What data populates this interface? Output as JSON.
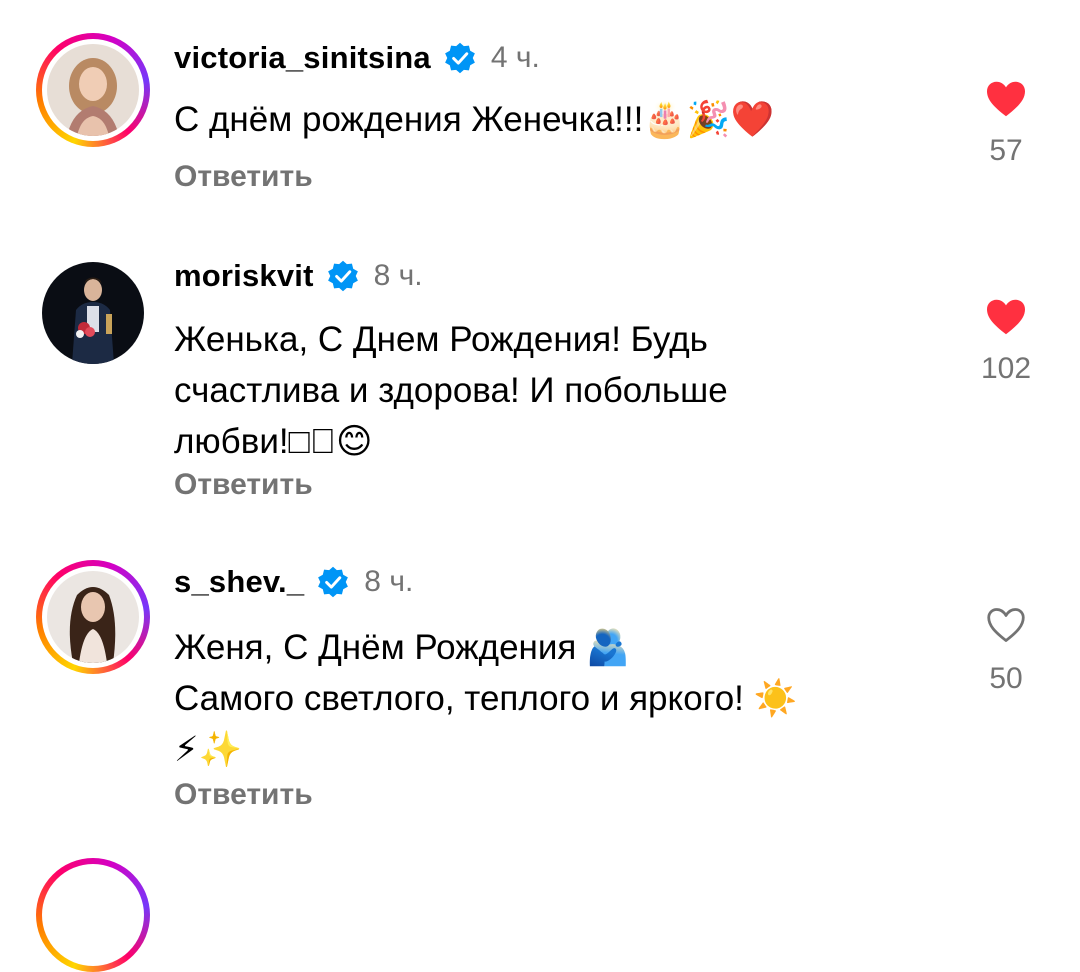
{
  "comments": [
    {
      "username": "victoria_sinitsina",
      "time": "4 ч.",
      "text": "С днём рождения Женечка!!!🎂🎉❤️",
      "reply_label": "Ответить",
      "likes": "57",
      "liked": true,
      "story_ring": true
    },
    {
      "username": "moriskvit",
      "time": "8 ч.",
      "text": "Женька, С Днем Рождения! Будь\nсчастлива и здорова! И побольше\nлюбви!□🏻😊",
      "reply_label": "Ответить",
      "likes": "102",
      "liked": true,
      "story_ring": false
    },
    {
      "username": "s_shev._",
      "time": "8 ч.",
      "text": "Женя, С Днём Рождения 🫂\nСамого светлого, теплого и яркого! ☀️\n⚡✨",
      "reply_label": "Ответить",
      "likes": "50",
      "liked": false,
      "story_ring": true
    }
  ],
  "colors": {
    "heart_liked": "#ff3040",
    "verified_badge": "#0095f6",
    "secondary_text": "#737373"
  },
  "icons": {
    "verified": "verified-badge-icon",
    "like_filled": "heart-filled-icon",
    "like_outline": "heart-outline-icon"
  }
}
